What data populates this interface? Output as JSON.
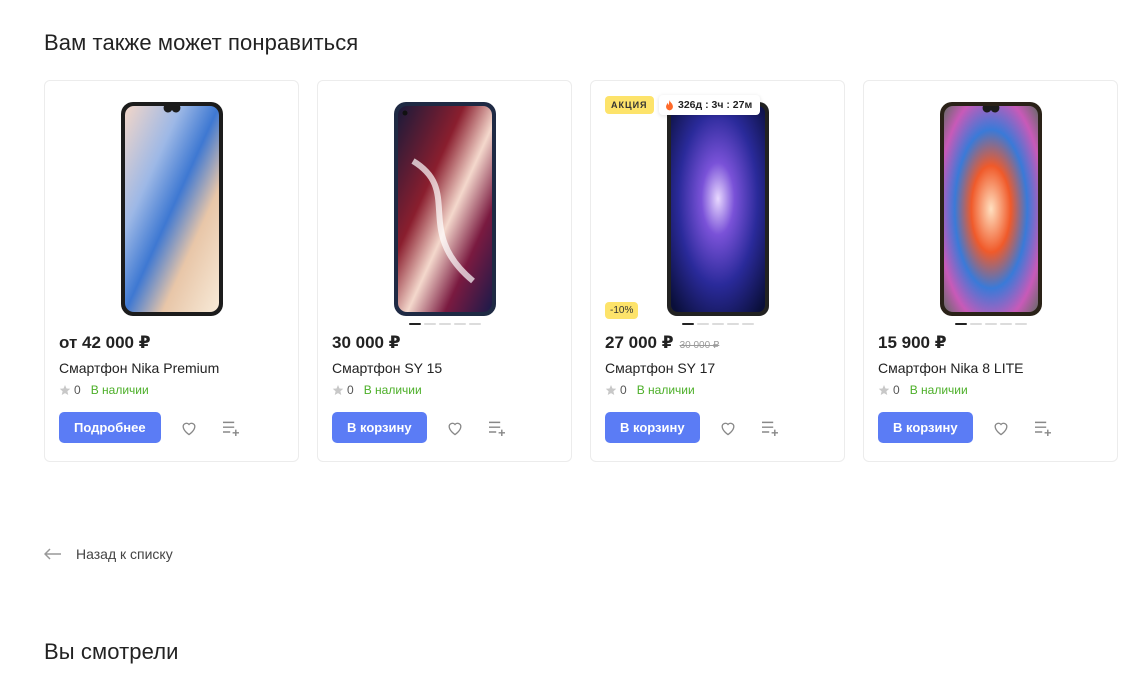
{
  "recommend": {
    "title": "Вам также может понравиться"
  },
  "cards": [
    {
      "price": "от 42 000 ₽",
      "old_price": "",
      "name": "Смартфон Nika Premium",
      "rating": "0",
      "stock": "В наличии",
      "button": "Подробнее",
      "active_dot": 0,
      "dots": 0
    },
    {
      "price": "30 000 ₽",
      "old_price": "",
      "name": "Смартфон SY 15",
      "rating": "0",
      "stock": "В наличии",
      "button": "В корзину",
      "active_dot": 0,
      "dots": 5
    },
    {
      "price": "27 000 ₽",
      "old_price": "30 000 ₽",
      "name": "Смартфон SY 17",
      "rating": "0",
      "stock": "В наличии",
      "button": "В корзину",
      "active_dot": 0,
      "dots": 5,
      "sale_badge": "АКЦИЯ",
      "timer": "326д : 3ч : 27м",
      "discount": "-10%"
    },
    {
      "price": "15 900 ₽",
      "old_price": "",
      "name": "Смартфон Nika 8 LITE",
      "rating": "0",
      "stock": "В наличии",
      "button": "В корзину",
      "active_dot": 0,
      "dots": 5
    }
  ],
  "back_link": "Назад к списку",
  "viewed": {
    "title": "Вы смотрели"
  },
  "colors": {
    "accent": "#5b7cf5",
    "stock": "#4caf28",
    "sale": "#fde36a"
  },
  "icons": [
    "star-icon",
    "heart-icon",
    "compare-list-icon",
    "fire-icon",
    "arrow-left-icon"
  ]
}
